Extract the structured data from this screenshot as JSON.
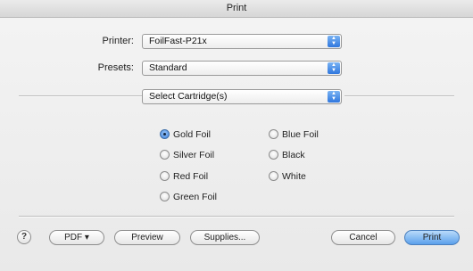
{
  "window": {
    "title": "Print"
  },
  "printer": {
    "label": "Printer:",
    "value": "FoilFast-P21x"
  },
  "presets": {
    "label": "Presets:",
    "value": "Standard"
  },
  "panel": {
    "value": "Select Cartridge(s)"
  },
  "cartridges": [
    {
      "label": "Gold Foil",
      "checked": true
    },
    {
      "label": "Silver Foil",
      "checked": false
    },
    {
      "label": "Red Foil",
      "checked": false
    },
    {
      "label": "Green Foil",
      "checked": false
    },
    {
      "label": "Blue Foil",
      "checked": false
    },
    {
      "label": "Black",
      "checked": false
    },
    {
      "label": "White",
      "checked": false
    }
  ],
  "footer": {
    "help": "?",
    "pdf": "PDF ▾",
    "preview": "Preview",
    "supplies": "Supplies...",
    "cancel": "Cancel",
    "print": "Print"
  },
  "colors": {
    "accent": "#3b7fdb",
    "default_button": "#5ba0ec"
  }
}
